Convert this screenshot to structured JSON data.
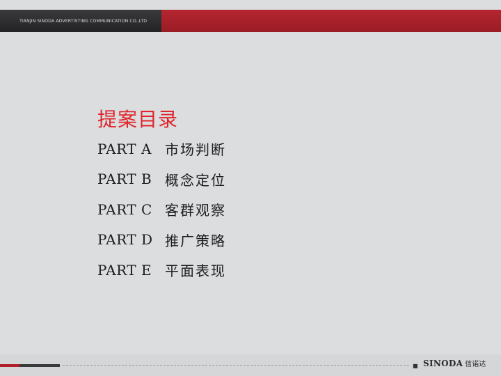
{
  "header": {
    "company_name": "TIANJIN SINODA ADVERTISTING COMMUNICATION CO.,LTD"
  },
  "toc": {
    "title": "提案目录",
    "items": [
      {
        "part": "PART A",
        "title": "市场判断"
      },
      {
        "part": "PART B",
        "title": "概念定位"
      },
      {
        "part": "PART C",
        "title": "客群观察"
      },
      {
        "part": "PART D",
        "title": "推广策略"
      },
      {
        "part": "PART E",
        "title": "平面表现"
      }
    ]
  },
  "footer": {
    "logo_text": "SINODA",
    "logo_cn": "信诺达"
  },
  "colors": {
    "accent_red": "#b01f2a",
    "title_red": "#e0252b",
    "dark_bar": "#2a2a2c",
    "background": "#dcdddf"
  }
}
